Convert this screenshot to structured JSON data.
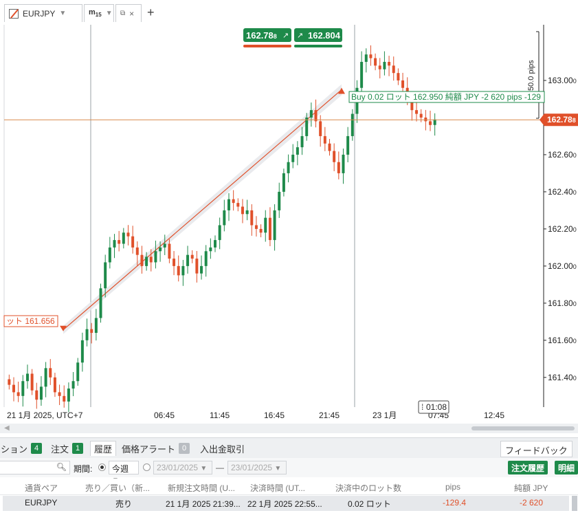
{
  "toolbar": {
    "symbol": "EURJPY",
    "timeframe_main": "m",
    "timeframe_sub": "15",
    "add_tab": "+",
    "close_glyph": "×",
    "caret": "▼"
  },
  "quote": {
    "bid": "162.78",
    "bid_small": "8",
    "ask": "162.804",
    "bid_color": "#e0502a",
    "ask_color": "#1e8a4a"
  },
  "price_axis": {
    "ticks": [
      {
        "label": "163.00",
        "suffix": "0",
        "value": 163.0
      },
      {
        "label": "162.60",
        "suffix": "0",
        "value": 162.6
      },
      {
        "label": "162.40",
        "suffix": "0",
        "value": 162.4
      },
      {
        "label": "162.20",
        "suffix": "0",
        "value": 162.2
      },
      {
        "label": "162.00",
        "suffix": "0",
        "value": 162.0
      },
      {
        "label": "161.80",
        "suffix": "0",
        "value": 161.8
      },
      {
        "label": "161.60",
        "suffix": "0",
        "value": 161.6
      },
      {
        "label": "161.40",
        "suffix": "0",
        "value": 161.4
      }
    ],
    "current_label": "162.78",
    "current_suffix": "8",
    "current_value": 162.788
  },
  "time_axis": {
    "labels": [
      {
        "text": "21 1月 2025, UTC+7"
      },
      {
        "text": "06:45"
      },
      {
        "text": "11:45"
      },
      {
        "text": "16:45"
      },
      {
        "text": "21:45"
      },
      {
        "text": "23 1月"
      },
      {
        "text": "07:45"
      },
      {
        "text": "12:45"
      }
    ],
    "cursor_time": "01:08"
  },
  "annotations": {
    "pips_measure": "50.0 pips",
    "trade_label": "Buy 0.02 ロット 162.950 純額 JPY -2 620 pips -129",
    "entry_label": "ット 161.656",
    "entry_price": 161.656,
    "exit_price": 162.95
  },
  "chart_data": {
    "type": "candlestick",
    "symbol": "EURJPY",
    "timeframe": "m15",
    "ylim": [
      161.24,
      163.3
    ],
    "current_price": 162.788,
    "series": [
      {
        "name": "EURJPY",
        "close": [
          161.36,
          161.32,
          161.3,
          161.38,
          161.42,
          161.33,
          161.28,
          161.35,
          161.45,
          161.4,
          161.32,
          161.3,
          161.27,
          161.34,
          161.38,
          161.48,
          161.6,
          161.66,
          161.64,
          161.72,
          161.88,
          162.02,
          162.1,
          162.14,
          162.12,
          162.18,
          162.16,
          162.1,
          162.06,
          162.0,
          162.05,
          162.02,
          162.08,
          162.1,
          162.12,
          162.04,
          162.0,
          161.95,
          162.0,
          162.06,
          162.04,
          161.96,
          162.0,
          162.08,
          162.1,
          162.14,
          162.22,
          162.3,
          162.36,
          162.34,
          162.32,
          162.28,
          162.3,
          162.22,
          162.2,
          162.18,
          162.26,
          162.14,
          162.3,
          162.4,
          162.5,
          162.56,
          162.6,
          162.64,
          162.7,
          162.8,
          162.84,
          162.78,
          162.7,
          162.66,
          162.62,
          162.56,
          162.5,
          162.6,
          162.7,
          162.82,
          162.96,
          163.1,
          163.14,
          163.12,
          163.08,
          163.06,
          163.1,
          163.08,
          163.04,
          163.0,
          162.96,
          162.9,
          162.84,
          162.82,
          162.8,
          162.78,
          162.76,
          162.79
        ]
      }
    ]
  },
  "bottom_panel": {
    "tabs": [
      {
        "label": "ション",
        "count": "4"
      },
      {
        "label": "注文",
        "count": "1"
      },
      {
        "label": "履歴",
        "count": ""
      },
      {
        "label": "価格アラート",
        "count": "0"
      },
      {
        "label": "入出金取引",
        "count": ""
      }
    ],
    "feedback_label": "フィードバック",
    "period_label": "期間:",
    "period_value": "今週",
    "date_from": "23/01/2025",
    "date_to": "23/01/2025",
    "dash": "—",
    "history_button": "注文履歴",
    "detail_button": "明細",
    "columns": [
      "通貨ペア",
      "売り／買い（新...",
      "新規注文時間 (U...",
      "決済時間 (UT...",
      "決済中のロット数",
      "pips",
      "純額 JPY"
    ],
    "rows": [
      {
        "pair": "EURJPY",
        "side": "売り",
        "open_time": "21 1月 2025 21:39...",
        "close_time": "22 1月 2025 22:55...",
        "lots": "0.02 ロット",
        "pips": "-129.4",
        "net": "-2 620"
      }
    ]
  }
}
